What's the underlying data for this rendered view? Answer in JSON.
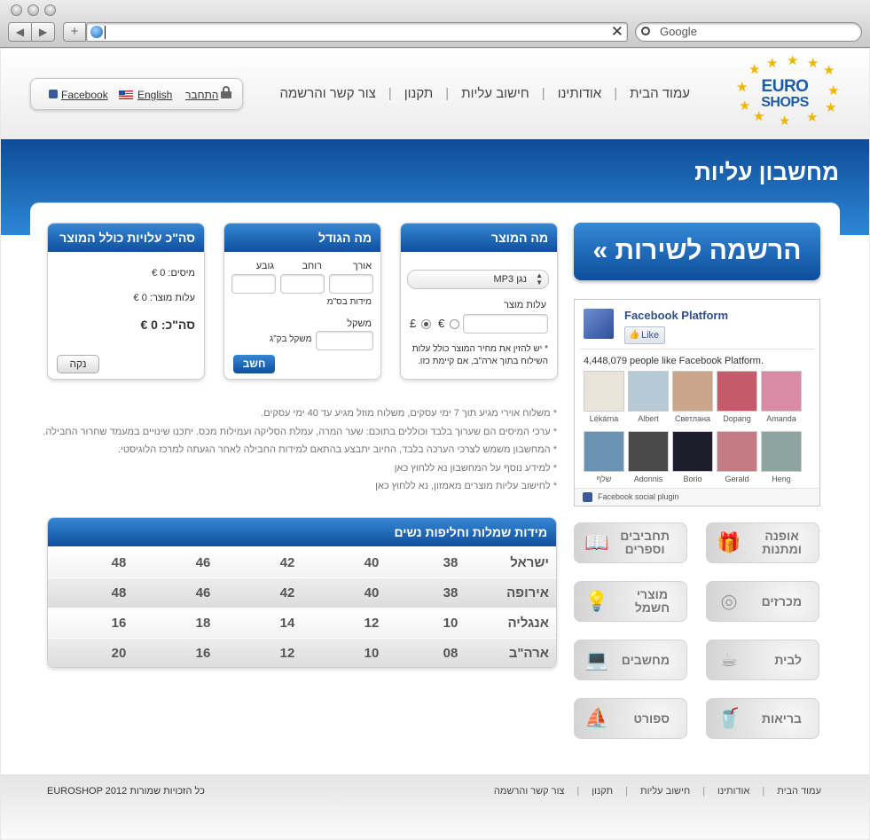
{
  "browser": {
    "back": "◀",
    "forward": "▶",
    "add": "+",
    "address": "",
    "clear": "✕",
    "search_placeholder": "Google"
  },
  "logo": {
    "line1": "EURO",
    "line2": "SHOPS"
  },
  "nav": {
    "items": [
      "עמוד הבית",
      "אודותינו",
      "חישוב עליות",
      "תקנון",
      "צור קשר והרשמה"
    ],
    "separator": "|"
  },
  "lang": {
    "facebook": "Facebook",
    "english": "English",
    "login": "התחבר"
  },
  "banner": {
    "title": "מחשבון עליות"
  },
  "product_card": {
    "title": "מה המוצר",
    "select_value": "נגן MP3",
    "cost_label": "עלות מוצר",
    "currency_euro": "€",
    "currency_pound": "£",
    "note": "* יש להזין את מחיר המוצר כולל עלות השילוח בתוך ארה\"ב, אם קיימת כזו."
  },
  "size_card": {
    "title": "מה הגודל",
    "length": "אורך",
    "width": "רוחב",
    "height": "גובע",
    "dims_note": "מידות בס\"מ",
    "weight": "משקל",
    "weight_note": "משקל בק\"ג",
    "calc_button": "חשב"
  },
  "total_card": {
    "title": "סה\"כ עלויות כולל המוצר",
    "taxes": "מיסים: 0 €",
    "product_cost": "עלות מוצר: 0 €",
    "total": "סה\"כ: 0 €",
    "clear_button": "נקה"
  },
  "promo": {
    "label": "הרשמה לשירות »"
  },
  "facebook_widget": {
    "title": "Facebook Platform",
    "like": "Like",
    "count_text": "4,448,079 people like Facebook Platform.",
    "people": [
      {
        "name": "Lékárna",
        "color": "#e9e4da"
      },
      {
        "name": "Albert",
        "color": "#b5c9d6"
      },
      {
        "name": "Светлана",
        "color": "#caa58a"
      },
      {
        "name": "Dopang",
        "color": "#c55a6b"
      },
      {
        "name": "Amanda",
        "color": "#d98aa5"
      },
      {
        "name": "שלף",
        "color": "#6a93b4"
      },
      {
        "name": "Adonnis",
        "color": "#4a4a4a"
      },
      {
        "name": "Borio",
        "color": "#1d1d2c"
      },
      {
        "name": "Gerald",
        "color": "#c47b83"
      },
      {
        "name": "Heng",
        "color": "#8ea4a0"
      }
    ],
    "footer": "Facebook social plugin"
  },
  "notes": [
    "* משלוח אוירי מגיע תוך 7 ימי עסקים, משלוח מוזל מגיע עד 40 ימי עסקים.",
    "* ערכי המיסים הם שערוך בלבד וכוללים בתוכם: שער המרה, עמלת הסליקה ועמילות מכס. יתכנו שינויים במעמד שחרור החבילה.",
    "* המחשבון משמש לצרכי הערכה בלבד, החיוב יתבצע בהתאם למידות החבילה לאחר הגעתה למרכז הלוגיסטי.",
    "* למידע נוסף על המחשבון נא ללחוץ כאן",
    "* לחישוב עליות מוצרים מאמזון, נא ללחוץ כאן"
  ],
  "sizes_table": {
    "title": "מידות שמלות וחליפות נשים",
    "rows": [
      {
        "name": "ישראל",
        "values": [
          "38",
          "40",
          "42",
          "46",
          "48"
        ]
      },
      {
        "name": "אירופה",
        "values": [
          "38",
          "40",
          "42",
          "46",
          "48"
        ]
      },
      {
        "name": "אנגליה",
        "values": [
          "10",
          "12",
          "14",
          "18",
          "16"
        ]
      },
      {
        "name": "ארה\"ב",
        "values": [
          "08",
          "10",
          "12",
          "16",
          "20"
        ]
      }
    ]
  },
  "categories": [
    {
      "label1": "אופנה",
      "label2": "ומתנות",
      "icon": "gift-icon",
      "glyph": "🎁"
    },
    {
      "label1": "תחביבים",
      "label2": "וספרים",
      "icon": "book-icon",
      "glyph": "📖"
    },
    {
      "label1": "מכרזים",
      "label2": "",
      "icon": "target-icon",
      "glyph": "◎"
    },
    {
      "label1": "מוצרי",
      "label2": "חשמל",
      "icon": "lamp-icon",
      "glyph": "💡"
    },
    {
      "label1": "לבית",
      "label2": "",
      "icon": "cup-icon",
      "glyph": "☕"
    },
    {
      "label1": "מחשבים",
      "label2": "",
      "icon": "laptop-icon",
      "glyph": "💻"
    },
    {
      "label1": "בריאות",
      "label2": "",
      "icon": "drink-icon",
      "glyph": "🥤"
    },
    {
      "label1": "ספורט",
      "label2": "",
      "icon": "sailboat-icon",
      "glyph": "⛵"
    }
  ],
  "footer": {
    "links": [
      "עמוד הבית",
      "אודותינו",
      "חישוב עליות",
      "תקנון",
      "צור קשר והרשמה"
    ],
    "copyright": "כל הזכויות שמורות EUROSHOP 2012"
  }
}
